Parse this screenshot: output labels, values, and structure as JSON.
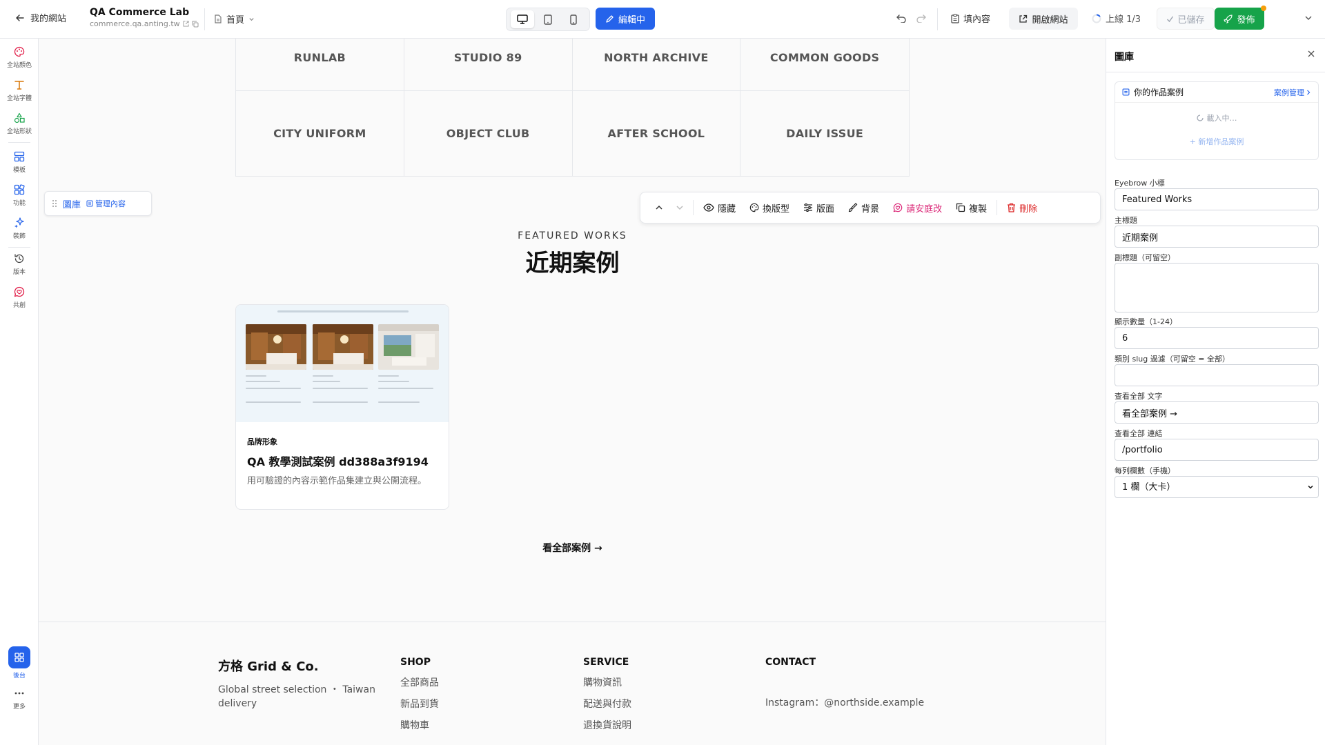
{
  "topbar": {
    "back_label": "我的網站",
    "site_name": "QA Commerce Lab",
    "site_url": "commerce.qa.anting.tw",
    "page_select": "首頁",
    "edit_label": "編輯中",
    "fill_content_label": "填內容",
    "open_site_label": "開啟網站",
    "online_label": "上線 1/3",
    "saved_label": "已儲存",
    "publish_label": "發佈"
  },
  "leftbar": {
    "items": [
      {
        "label": "全站顏色",
        "icon": "palette-icon",
        "color": "#e11d48"
      },
      {
        "label": "全站字體",
        "icon": "type-icon",
        "color": "#d97706"
      },
      {
        "label": "全站形狀",
        "icon": "shapes-icon",
        "color": "#16a34a"
      },
      {
        "label": "模板",
        "icon": "layout-icon",
        "color": "#2563eb"
      },
      {
        "label": "功能",
        "icon": "widgets-icon",
        "color": "#2563eb"
      },
      {
        "label": "裝飾",
        "icon": "sparkle-icon",
        "color": "#2563eb"
      },
      {
        "label": "版本",
        "icon": "history-icon",
        "color": "#444444"
      },
      {
        "label": "共創",
        "icon": "cocreate-icon",
        "color": "#e11d48"
      }
    ],
    "backend_label": "後台",
    "more_label": "更多"
  },
  "canvas": {
    "logos_top": [
      "RUNLAB",
      "STUDIO 89",
      "NORTH ARCHIVE",
      "COMMON GOODS"
    ],
    "logos_bottom": [
      "CITY UNIFORM",
      "OBJECT CLUB",
      "AFTER SCHOOL",
      "DAILY ISSUE"
    ],
    "section_label": "圖庫",
    "section_manage": "管理內容",
    "toolbar": {
      "hide": "隱藏",
      "swap_layout": "換版型",
      "layout": "版面",
      "background": "背景",
      "ask_ai": "請安庭改",
      "duplicate": "複製",
      "delete": "刪除"
    },
    "eyebrow": "FEATURED WORKS",
    "title": "近期案例",
    "card": {
      "category": "品牌形象",
      "title": "QA 教學測試案例 dd388a3f9194",
      "description": "用可驗證的內容示範作品集建立與公開流程。"
    },
    "view_all": "看全部案例 →"
  },
  "footer": {
    "brand": "方格 Grid & Co.",
    "tagline": "Global street selection ・ Taiwan delivery",
    "shop_head": "SHOP",
    "shop_links": [
      "全部商品",
      "新品到貨",
      "購物車"
    ],
    "service_head": "SERVICE",
    "service_links": [
      "購物資訊",
      "配送與付款",
      "退換貨說明"
    ],
    "contact_head": "CONTACT",
    "contact_line": "Instagram：@northside.example"
  },
  "panel": {
    "title": "圖庫",
    "portfolio_label": "你的作品案例",
    "portfolio_manage": "案例管理",
    "loading": "載入中…",
    "add_case": "+ 新增作品案例",
    "eyebrow_label": "Eyebrow 小標",
    "eyebrow_value": "Featured Works",
    "title_label": "主標題",
    "title_value": "近期案例",
    "subtitle_label": "副標題（可留空）",
    "subtitle_value": "",
    "count_label": "顯示數量（1-24）",
    "count_value": "6",
    "slug_label": "類別 slug 過濾（可留空 = 全部）",
    "slug_value": "",
    "viewall_text_label": "查看全部 文字",
    "viewall_text_value": "看全部案例 →",
    "viewall_link_label": "查看全部 連結",
    "viewall_link_value": "/portfolio",
    "columns_label": "每列欄數（手機）",
    "columns_value": "1 欄（大卡）"
  },
  "colors": {
    "accent": "#2563eb",
    "publish": "#16a34a",
    "danger": "#dc2626"
  }
}
